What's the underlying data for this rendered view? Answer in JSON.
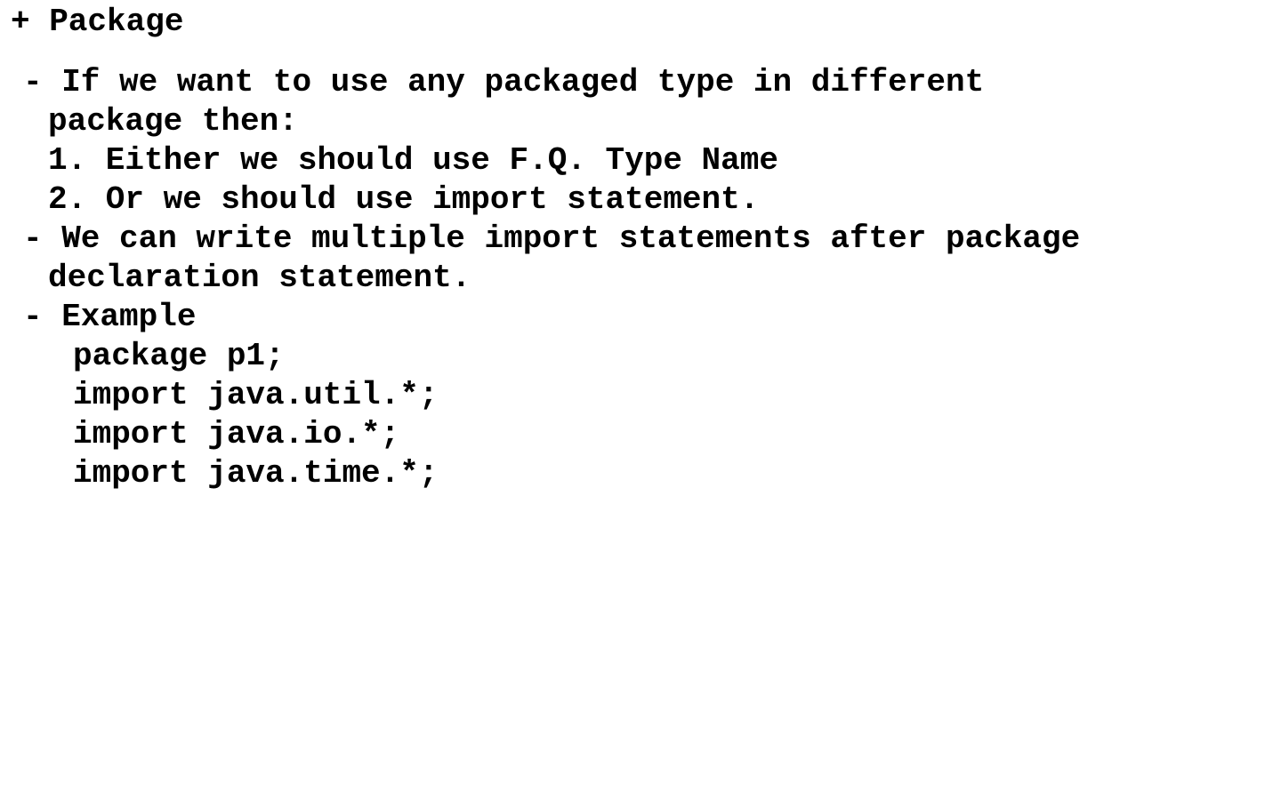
{
  "document": {
    "heading": "+ Package",
    "lines": [
      "- If we want to use any packaged type in different",
      "package then:",
      "1. Either we should use F.Q. Type Name",
      "2. Or we should use import statement.",
      "- We can write multiple import statements after package",
      "declaration statement.",
      "- Example",
      "package p1;",
      "import java.util.*;",
      "import java.io.*;",
      "import java.time.*;"
    ]
  },
  "colors": {
    "background": "#ffffff",
    "text": "#000000"
  }
}
